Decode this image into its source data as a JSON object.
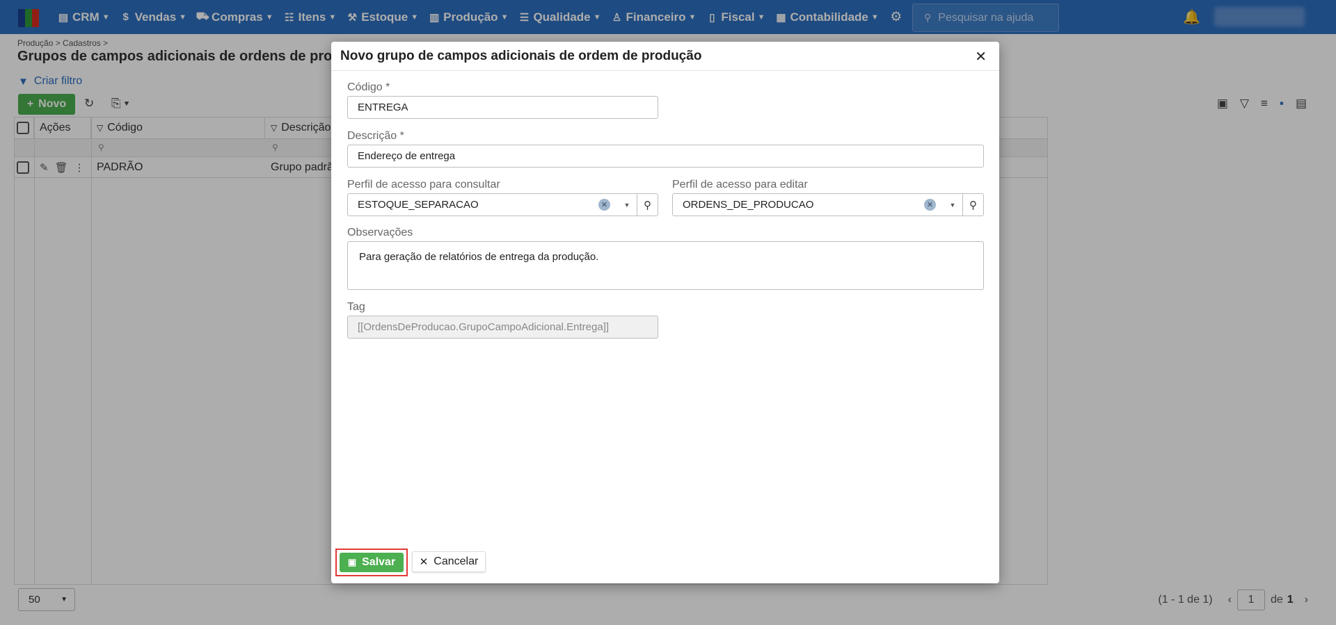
{
  "nav": {
    "items": [
      {
        "label": "CRM",
        "icon": "crm-icon",
        "glyph": "▤"
      },
      {
        "label": "Vendas",
        "icon": "dollar-icon",
        "glyph": "$"
      },
      {
        "label": "Compras",
        "icon": "cart-icon",
        "glyph": "🛒"
      },
      {
        "label": "Itens",
        "icon": "items-icon",
        "glyph": "☷"
      },
      {
        "label": "Estoque",
        "icon": "stock-icon",
        "glyph": "⚒"
      },
      {
        "label": "Produção",
        "icon": "factory-icon",
        "glyph": "▥"
      },
      {
        "label": "Qualidade",
        "icon": "quality-icon",
        "glyph": "☰"
      },
      {
        "label": "Financeiro",
        "icon": "finance-icon",
        "glyph": "♙"
      },
      {
        "label": "Fiscal",
        "icon": "fiscal-icon",
        "glyph": "▯"
      },
      {
        "label": "Contabilidade",
        "icon": "accounting-icon",
        "glyph": "▦"
      }
    ],
    "help_search_placeholder": "Pesquisar na ajuda"
  },
  "page": {
    "breadcrumb": "Produção > Cadastros >",
    "title": "Grupos de campos adicionais de ordens de produção",
    "criar_filtro": "Criar filtro",
    "novo_label": "Novo",
    "columns": [
      "Ações",
      "Código",
      "Descrição"
    ],
    "rows": [
      {
        "codigo": "PADRÃO",
        "descricao": "Grupo padrão"
      }
    ],
    "page_size": "50",
    "pager_summary": "(1 - 1 de 1)",
    "pager_current": "1",
    "pager_of": "de",
    "pager_total": "1"
  },
  "modal": {
    "title": "Novo grupo de campos adicionais de ordem de produção",
    "codigo_label": "Código *",
    "codigo_value": "ENTREGA",
    "descricao_label": "Descrição *",
    "descricao_value": "Endereço de entrega",
    "perfil_consultar_label": "Perfil de acesso para consultar",
    "perfil_consultar_value": "ESTOQUE_SEPARACAO",
    "perfil_editar_label": "Perfil de acesso para editar",
    "perfil_editar_value": "ORDENS_DE_PRODUCAO",
    "observacoes_label": "Observações",
    "observacoes_value": "Para geração de relatórios de entrega da produção.",
    "tag_label": "Tag",
    "tag_value": "[[OrdensDeProducao.GrupoCampoAdicional.Entrega]]",
    "save_label": "Salvar",
    "cancel_label": "Cancelar"
  },
  "colors": {
    "topbar": "#2d6fbf",
    "primary_button": "#4caf50",
    "highlight_border": "#e53935"
  }
}
